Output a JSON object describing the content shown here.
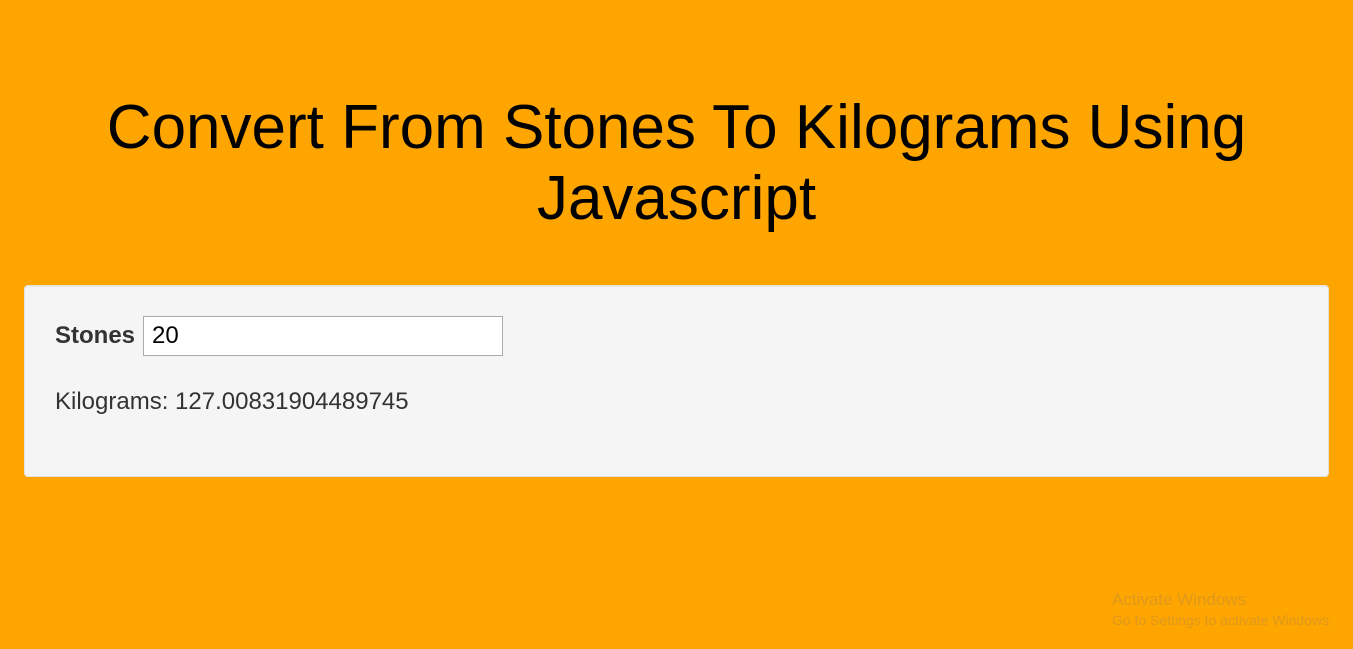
{
  "header": {
    "title": "Convert From Stones To Kilograms Using Javascript"
  },
  "form": {
    "stones_label": "Stones",
    "stones_value": "20"
  },
  "result": {
    "text": "Kilograms: 127.00831904489745"
  },
  "watermark": {
    "line1": "Activate Windows",
    "line2": "Go to Settings to activate Windows."
  },
  "colors": {
    "background": "#ffa500",
    "panel": "#f5f5f5"
  }
}
